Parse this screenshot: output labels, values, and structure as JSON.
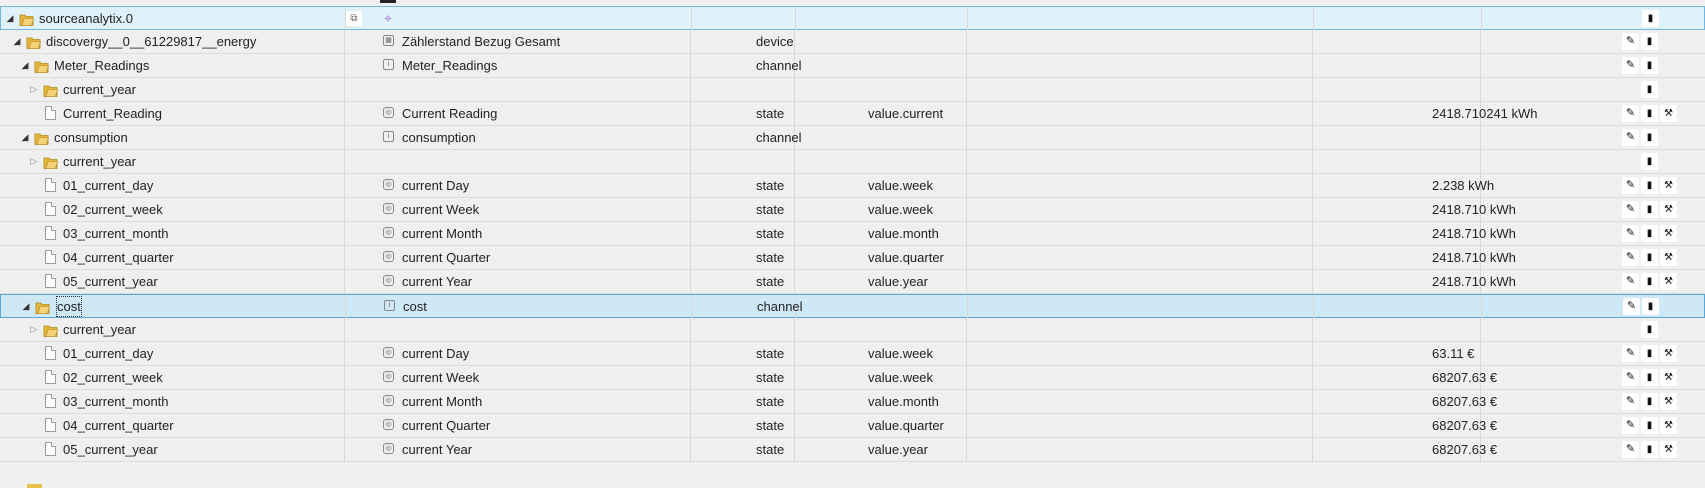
{
  "colors": {
    "folder": "#e4b73a",
    "selection_border": "#72b7e0",
    "selection_bg": "#dff1fb",
    "cross_icon": "#b07ad6"
  },
  "icons": {
    "expanded": "triangle-down-icon",
    "collapsed": "triangle-right-icon",
    "folder": "folder-icon",
    "state": "file-icon",
    "edit": "pencil-icon",
    "delete": "trash-icon",
    "config": "wrench-icon"
  },
  "rows": [
    {
      "name": "sourceanalytix.0",
      "title": "",
      "type": "",
      "role": "",
      "value": "",
      "indent": 0,
      "kind": "folder",
      "toggle": "open",
      "actions": [
        "trash"
      ],
      "sel": "sel",
      "copy": true,
      "cross": true
    },
    {
      "name": "discovergy__0__61229817__energy",
      "title": "Zählerstand Bezug Gesamt",
      "ticon": "meter",
      "type": "device",
      "role": "",
      "value": "",
      "indent": 1,
      "kind": "folder",
      "toggle": "open",
      "actions": [
        "edit",
        "trash"
      ]
    },
    {
      "name": "Meter_Readings",
      "title": "Meter_Readings",
      "ticon": "chan",
      "type": "channel",
      "role": "",
      "value": "",
      "indent": 2,
      "kind": "folder",
      "toggle": "open",
      "actions": [
        "edit",
        "trash"
      ]
    },
    {
      "name": "current_year",
      "title": "",
      "type": "",
      "role": "",
      "value": "",
      "indent": 3,
      "kind": "folder",
      "toggle": "closed",
      "actions": [
        "trash"
      ]
    },
    {
      "name": "Current_Reading",
      "title": "Current Reading",
      "ticon": "state",
      "type": "state",
      "role": "value.current",
      "value": "2418.710241 kWh",
      "indent": 3,
      "kind": "state",
      "toggle": "",
      "actions": [
        "edit",
        "trash",
        "wrench"
      ]
    },
    {
      "name": "consumption",
      "title": "consumption",
      "ticon": "chan",
      "type": "channel",
      "role": "",
      "value": "",
      "indent": 2,
      "kind": "folder",
      "toggle": "open",
      "actions": [
        "edit",
        "trash"
      ]
    },
    {
      "name": "current_year",
      "title": "",
      "type": "",
      "role": "",
      "value": "",
      "indent": 3,
      "kind": "folder",
      "toggle": "closed",
      "actions": [
        "trash"
      ]
    },
    {
      "name": "01_current_day",
      "title": "current Day",
      "ticon": "state",
      "type": "state",
      "role": "value.week",
      "value": "2.238 kWh",
      "indent": 3,
      "kind": "state",
      "toggle": "",
      "actions": [
        "edit",
        "trash",
        "wrench"
      ]
    },
    {
      "name": "02_current_week",
      "title": "current Week",
      "ticon": "state",
      "type": "state",
      "role": "value.week",
      "value": "2418.710 kWh",
      "indent": 3,
      "kind": "state",
      "toggle": "",
      "actions": [
        "edit",
        "trash",
        "wrench"
      ]
    },
    {
      "name": "03_current_month",
      "title": "current Month",
      "ticon": "state",
      "type": "state",
      "role": "value.month",
      "value": "2418.710 kWh",
      "indent": 3,
      "kind": "state",
      "toggle": "",
      "actions": [
        "edit",
        "trash",
        "wrench"
      ]
    },
    {
      "name": "04_current_quarter",
      "title": "current Quarter",
      "ticon": "state",
      "type": "state",
      "role": "value.quarter",
      "value": "2418.710 kWh",
      "indent": 3,
      "kind": "state",
      "toggle": "",
      "actions": [
        "edit",
        "trash",
        "wrench"
      ]
    },
    {
      "name": "05_current_year",
      "title": "current Year",
      "ticon": "state",
      "type": "state",
      "role": "value.year",
      "value": "2418.710 kWh",
      "indent": 3,
      "kind": "state",
      "toggle": "",
      "actions": [
        "edit",
        "trash",
        "wrench"
      ]
    },
    {
      "name": "cost",
      "title": "cost",
      "ticon": "chan",
      "type": "channel",
      "role": "",
      "value": "",
      "indent": 2,
      "kind": "folder",
      "toggle": "open",
      "actions": [
        "edit",
        "trash"
      ],
      "sel": "sel2",
      "focus": true
    },
    {
      "name": "current_year",
      "title": "",
      "type": "",
      "role": "",
      "value": "",
      "indent": 3,
      "kind": "folder",
      "toggle": "closed",
      "actions": [
        "trash"
      ]
    },
    {
      "name": "01_current_day",
      "title": "current Day",
      "ticon": "state",
      "type": "state",
      "role": "value.week",
      "value": "63.11 €",
      "indent": 3,
      "kind": "state",
      "toggle": "",
      "actions": [
        "edit",
        "trash",
        "wrench"
      ]
    },
    {
      "name": "02_current_week",
      "title": "current Week",
      "ticon": "state",
      "type": "state",
      "role": "value.week",
      "value": "68207.63 €",
      "indent": 3,
      "kind": "state",
      "toggle": "",
      "actions": [
        "edit",
        "trash",
        "wrench"
      ]
    },
    {
      "name": "03_current_month",
      "title": "current Month",
      "ticon": "state",
      "type": "state",
      "role": "value.month",
      "value": "68207.63 €",
      "indent": 3,
      "kind": "state",
      "toggle": "",
      "actions": [
        "edit",
        "trash",
        "wrench"
      ]
    },
    {
      "name": "04_current_quarter",
      "title": "current Quarter",
      "ticon": "state",
      "type": "state",
      "role": "value.quarter",
      "value": "68207.63 €",
      "indent": 3,
      "kind": "state",
      "toggle": "",
      "actions": [
        "edit",
        "trash",
        "wrench"
      ]
    },
    {
      "name": "05_current_year",
      "title": "current Year",
      "ticon": "state",
      "type": "state",
      "role": "value.year",
      "value": "68207.63 €",
      "indent": 3,
      "kind": "state",
      "toggle": "",
      "actions": [
        "edit",
        "trash",
        "wrench"
      ]
    }
  ]
}
